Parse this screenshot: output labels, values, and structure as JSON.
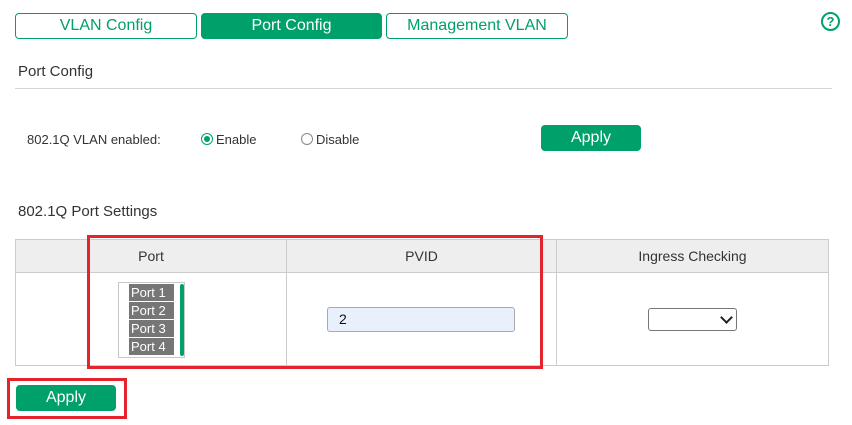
{
  "tabs": [
    {
      "label": "VLAN Config",
      "active": false
    },
    {
      "label": "Port Config",
      "active": true
    },
    {
      "label": "Management VLAN",
      "active": false
    }
  ],
  "help_icon": "question-mark-icon",
  "port_config": {
    "title": "Port Config",
    "vlan_enabled_label": "802.1Q VLAN enabled:",
    "options": [
      {
        "label": "Enable",
        "checked": true
      },
      {
        "label": "Disable",
        "checked": false
      }
    ],
    "apply_label": "Apply"
  },
  "port_settings": {
    "title": "802.1Q Port Settings",
    "columns": [
      "Port",
      "PVID",
      "Ingress Checking"
    ],
    "ports": [
      "Port 1",
      "Port 2",
      "Port 3",
      "Port 4"
    ],
    "pvid_value": "2",
    "ingress_value": ""
  },
  "bottom_apply_label": "Apply",
  "colors": {
    "accent": "#00a06a",
    "highlight": "#e5232b"
  }
}
